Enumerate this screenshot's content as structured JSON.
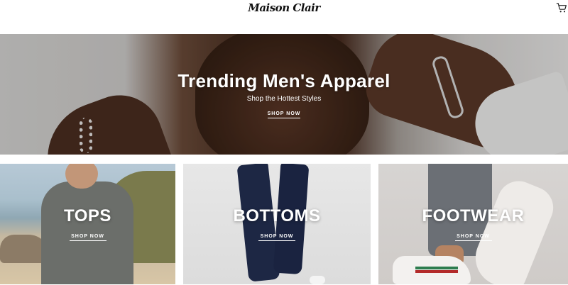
{
  "header": {
    "logo_text": "Maison Clair",
    "cart_icon": "shopping-cart-icon"
  },
  "hero": {
    "title": "Trending Men's Apparel",
    "subtitle": "Shop the Hottest Styles",
    "cta": "SHOP NOW"
  },
  "categories": [
    {
      "label": "TOPS",
      "cta": "SHOP NOW"
    },
    {
      "label": "BOTTOMS",
      "cta": "SHOP NOW"
    },
    {
      "label": "FOOTWEAR",
      "cta": "SHOP NOW"
    }
  ],
  "colors": {
    "text_on_image": "#ffffff",
    "header_bg": "#ffffff",
    "logo": "#111111"
  }
}
